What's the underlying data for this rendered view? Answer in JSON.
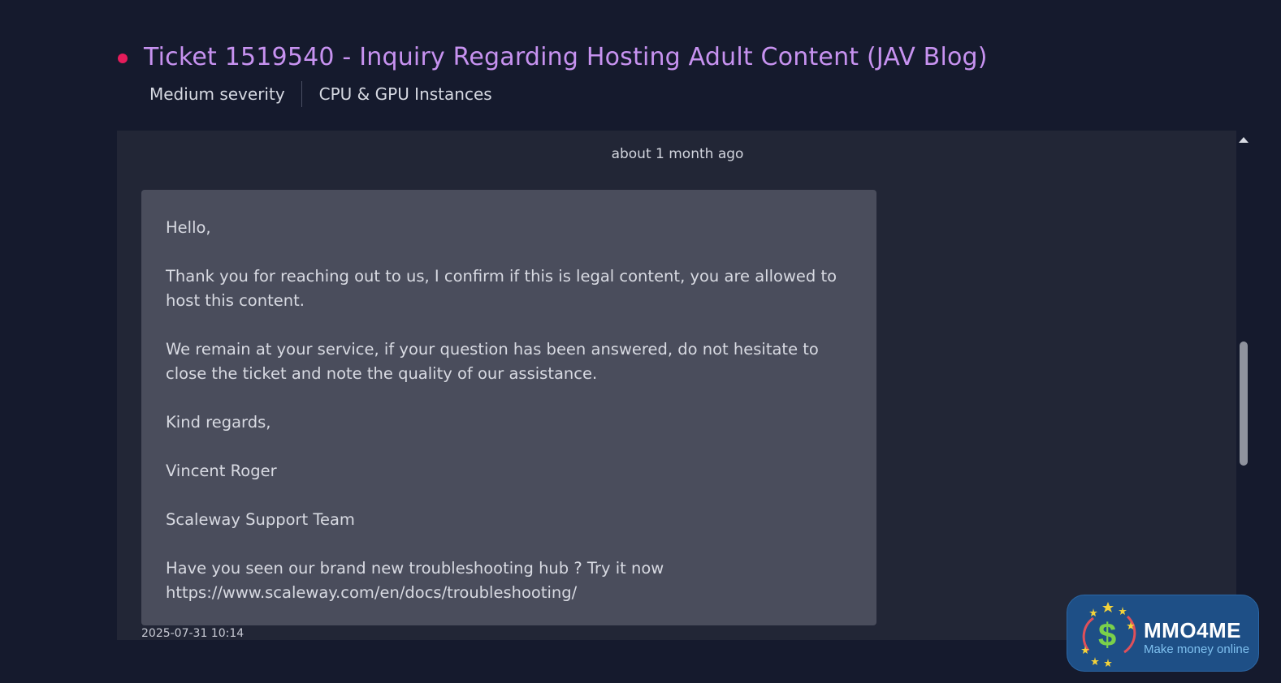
{
  "ticket": {
    "title": "Ticket 1519540 - Inquiry Regarding Hosting Adult Content (JAV Blog)",
    "severity": "Medium severity",
    "category": "CPU & GPU Instances"
  },
  "conversation": {
    "relative_time": "about 1 month ago",
    "message": {
      "paragraphs": [
        "Hello,",
        "Thank you for reaching out to us, I confirm if this is legal content, you are allowed to host this content.",
        "We remain at your service, if your question has been answered, do not hesitate to close the ticket and note the quality of our assistance.",
        "Kind regards,",
        "Vincent Roger",
        "Scaleway Support Team",
        "Have you seen our brand new troubleshooting hub ? Try it now https://www.scaleway.com/en/docs/troubleshooting/"
      ],
      "date": "2025-07-31 10:14"
    }
  },
  "watermark": {
    "brand": "MMO4ME",
    "tagline": "Make money online"
  },
  "colors": {
    "status_dot": "#e51c5b",
    "title": "#c792f0",
    "background": "#151a2d",
    "panel": "#222636",
    "message_bg": "#4a4d5c"
  },
  "icons": {
    "status": "status-dot-icon",
    "scroll_up": "chevron-up-icon",
    "logo": "dollar-coin-icon"
  }
}
